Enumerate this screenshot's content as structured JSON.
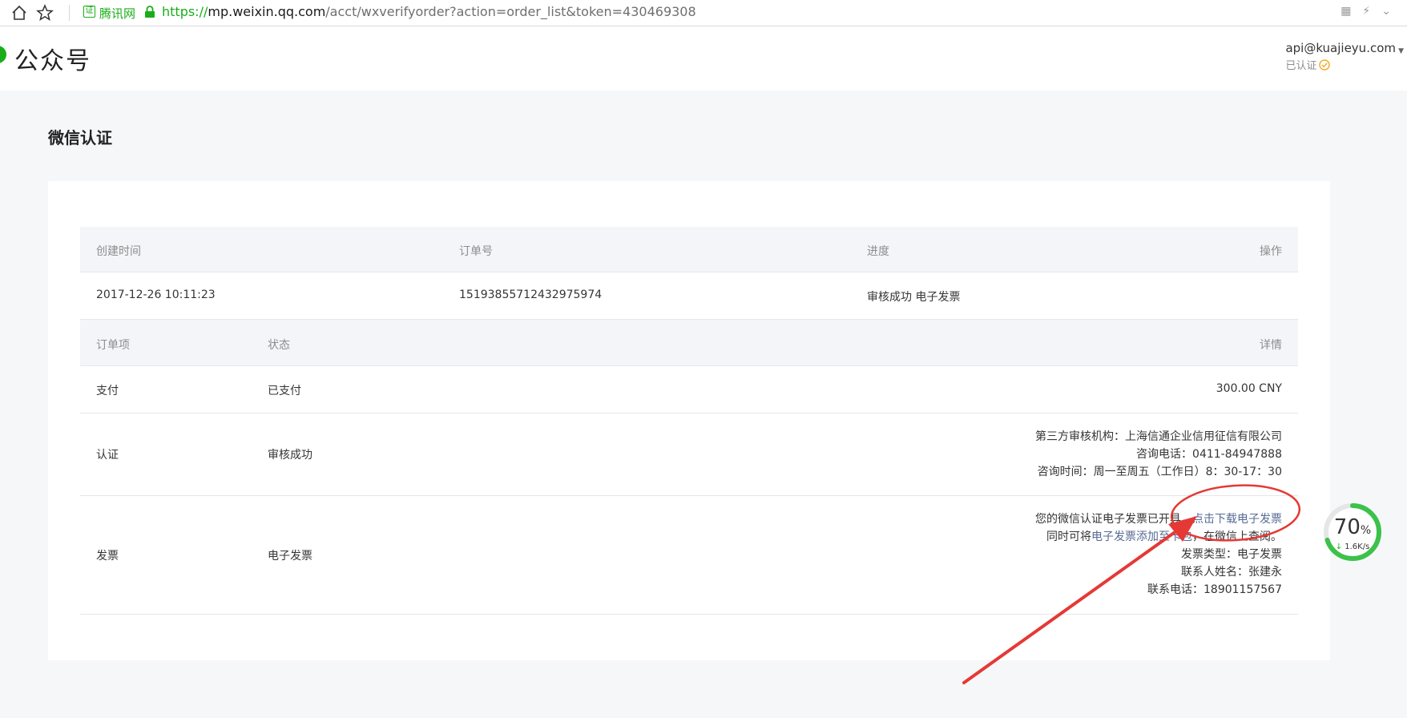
{
  "browser": {
    "cert_label": "腾讯网",
    "url_scheme": "https://",
    "url_host": "mp.weixin.qq.com",
    "url_path": "/acct/wxverifyorder?action=order_list&token=430469308"
  },
  "header": {
    "brand": "公众号",
    "account_email": "api@kuajieyu.com",
    "account_status": "已认证"
  },
  "page": {
    "title": "微信认证"
  },
  "order_table": {
    "headers": {
      "created": "创建时间",
      "order_no": "订单号",
      "progress": "进度",
      "action": "操作"
    },
    "row": {
      "created": "2017-12-26 10:11:23",
      "order_no": "15193855712432975974",
      "progress": "审核成功 电子发票"
    }
  },
  "items_table": {
    "headers": {
      "item": "订单项",
      "status": "状态",
      "detail": "详情"
    },
    "rows": [
      {
        "item": "支付",
        "status": "已支付",
        "detail": "300.00 CNY"
      },
      {
        "item": "认证",
        "status": "审核成功",
        "detail_lines": [
          "第三方审核机构：上海信通企业信用征信有限公司",
          "咨询电话：0411-84947888",
          "咨询时间：周一至周五（工作日）8：30-17：30"
        ]
      },
      {
        "item": "发票",
        "status": "电子发票",
        "invoice_line1_prefix": "您的微信认证电子发票已开具，",
        "invoice_download_link": "点击下载电子发票",
        "invoice_line2_prefix": "同时可将",
        "invoice_wallet_link": "电子发票添加至卡包",
        "invoice_line2_suffix": "，在微信上查阅。",
        "detail_lines": [
          "发票类型：电子发票",
          "联系人姓名：张建永",
          "联系电话：18901157567"
        ]
      }
    ]
  },
  "speed_widget": {
    "percent": "70",
    "percent_unit": "%",
    "rate": "1.6K/s",
    "progress": 0.7
  }
}
